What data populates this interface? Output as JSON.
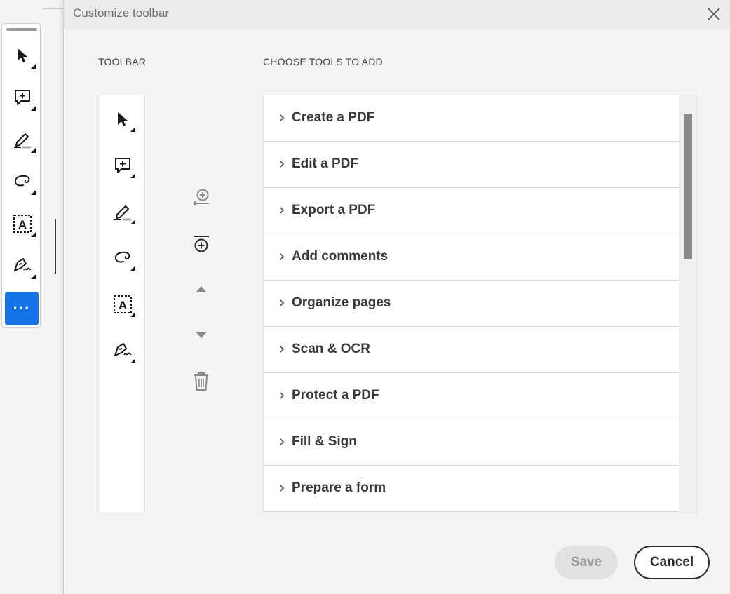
{
  "dialog": {
    "title": "Customize toolbar",
    "toolbar_heading": "TOOLBAR",
    "tools_heading": "CHOOSE TOOLS TO ADD",
    "toolbar_items": [
      {
        "icon": "select-arrow-icon"
      },
      {
        "icon": "add-comment-icon"
      },
      {
        "icon": "highlight-pen-icon"
      },
      {
        "icon": "freeform-draw-icon"
      },
      {
        "icon": "text-box-icon"
      },
      {
        "icon": "sign-pen-icon"
      }
    ],
    "controls": [
      {
        "icon": "add-to-toolbar-icon"
      },
      {
        "icon": "add-divider-icon"
      },
      {
        "icon": "move-up-icon"
      },
      {
        "icon": "move-down-icon"
      },
      {
        "icon": "delete-icon"
      }
    ],
    "tool_groups": [
      "Create a PDF",
      "Edit a PDF",
      "Export a PDF",
      "Add comments",
      "Organize pages",
      "Scan & OCR",
      "Protect a PDF",
      "Fill & Sign",
      "Prepare a form"
    ],
    "save_label": "Save",
    "cancel_label": "Cancel"
  },
  "background_toolbar": {
    "more_label": "···",
    "items": [
      "select-arrow-icon",
      "add-comment-icon",
      "highlight-pen-icon",
      "freeform-draw-icon",
      "text-box-icon",
      "sign-pen-icon",
      "more-tools-icon"
    ]
  },
  "colors": {
    "accent": "#1473e6",
    "dialog_bg": "#f4f4f4",
    "disabled": "#9a9a9a"
  }
}
